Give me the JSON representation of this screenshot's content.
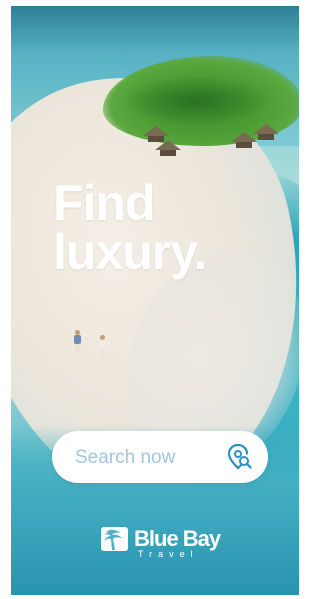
{
  "hero": {
    "headline_line1": "Find",
    "headline_line2": "luxury."
  },
  "search": {
    "label": "Search now",
    "icon": "location-search-icon"
  },
  "brand": {
    "name": "Blue Bay",
    "subtitle": "Travel",
    "icon": "palm-tree-logo"
  },
  "colors": {
    "search_text": "#9fc6de",
    "search_icon": "#2c8fc9",
    "headline": "#ffffff"
  }
}
